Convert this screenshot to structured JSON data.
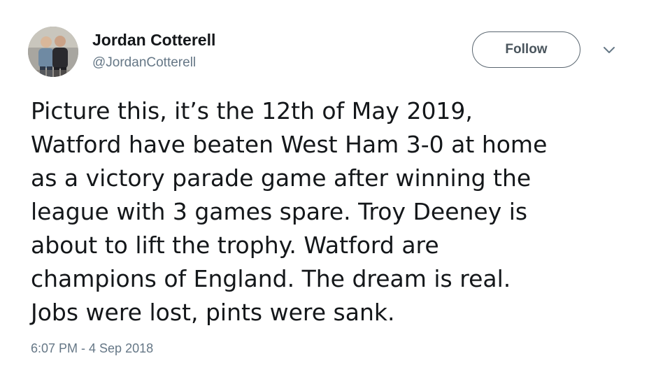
{
  "tweet": {
    "display_name": "Jordan Cotterell",
    "handle": "@JordanCotterell",
    "follow_label": "Follow",
    "body": "Picture this, it’s the 12th of May 2019,\nWatford have beaten West Ham 3-0 at home\nas a victory parade game after winning the\nleague with 3 games spare. Troy Deeney is\nabout to lift the trophy. Watford are\nchampions of England. The dream is real.\nJobs were lost, pints were sank.",
    "timestamp": "6:07 PM - 4 Sep 2018"
  },
  "icons": {
    "avatar": "user-avatar-photo",
    "more": "chevron-down-icon"
  },
  "colors": {
    "text_primary": "#14171a",
    "text_secondary": "#657786",
    "button_border": "#5a6670",
    "background": "#ffffff"
  }
}
